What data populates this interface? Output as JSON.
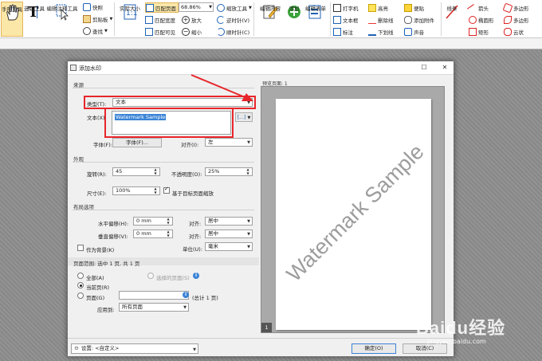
{
  "ribbon": {
    "hand_tool": "手形工具",
    "select_tool": "选取工具",
    "select_annotation": "编辑注释工具",
    "snapshot": "快照",
    "clipboard": "剪贴板",
    "find": "查找",
    "actual_size": "实际大小",
    "fit_page": "匹配页面",
    "fit_width": "匹配宽度",
    "fit_visible": "匹配可见",
    "zoom_value": "68.86%",
    "zoom_tool": "缩放工具",
    "zoom_in": "放大",
    "zoom_out": "缩小",
    "rotate_left": "逆时针(V)",
    "rotate_right": "顺时针(C)",
    "edit_content": "编辑内容",
    "add": "添加",
    "edit_form": "编辑表单",
    "typewriter": "打字机",
    "textbox": "文本框",
    "callout": "标注",
    "highlight": "高亮",
    "strikeout": "删除线",
    "underline": "下划线",
    "note": "便贴",
    "attach": "添加附件",
    "sound": "声音",
    "line_tool": "线条",
    "arrow": "箭头",
    "ellipse": "椭圆形",
    "rectangle": "矩形",
    "polygon": "多边形",
    "polyline": "多边形",
    "cloud": "云状"
  },
  "dialog": {
    "title": "添加水印",
    "source_section": "来源",
    "type_label": "类型(T):",
    "type_value": "文本",
    "text_label": "文本(X):",
    "text_value": "Watermark Sample",
    "font_label": "字体(F):",
    "font_button": "字体(F)...",
    "align_label": "对齐(I):",
    "align_value": "左",
    "appearance_section": "外观",
    "rotation_label": "旋转(R):",
    "rotation_value": "45",
    "opacity_label": "不透明度(O):",
    "opacity_value": "25%",
    "size_label": "尺寸(E):",
    "size_value": "100%",
    "relative_label": "基于目标页面缩放",
    "layout_section": "布局选项",
    "hoffset_label": "水平偏移(H):",
    "hoffset_value": "0 mm",
    "voffset_label": "垂直偏移(V):",
    "voffset_value": "0 mm",
    "halign_label": "对齐:",
    "halign_value": "居中",
    "valign_label": "对齐:",
    "valign_value": "居中",
    "unit_label": "单位(U):",
    "unit_value": "毫米",
    "background_label": "作为背景(K)",
    "range_section": "页面范围: 选中 1 页, 共 1 页",
    "all_label": "全部(A)",
    "selected_pages_label": "选择的页面(S)",
    "current_label": "当前页(R)",
    "pages_label": "页面(G)",
    "total_label": "(总计 1 页)",
    "apply_to_label": "应用到:",
    "apply_to_value": "所有页面",
    "settings_label": "设置:",
    "settings_value": "<自定义>",
    "ok_button": "确定(O)",
    "cancel_button": "取消(C)",
    "preview_label": "预览页面: 1",
    "preview_watermark": "Watermark Sample",
    "page_number": "1"
  },
  "watermark_site": {
    "logo": "Baidu经验",
    "url": "jingyan.baidu.com"
  },
  "colors": {
    "annotation_red": "#e8262b",
    "selection_blue": "#3a83d6",
    "ribbon_selected": "#fbe7a8"
  }
}
